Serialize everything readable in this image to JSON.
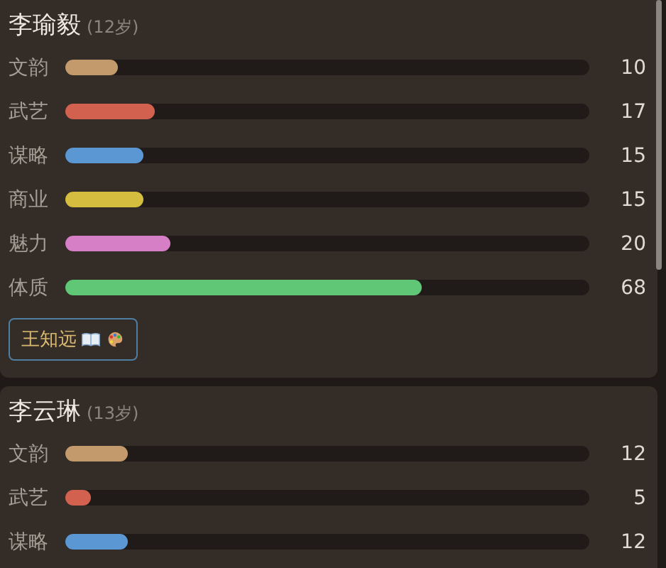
{
  "characters": [
    {
      "name": "李瑜毅",
      "age": "(12岁)",
      "stats": [
        {
          "label": "文韵",
          "level": 0.1,
          "value": "10",
          "color": "#c39a6b"
        },
        {
          "label": "武艺",
          "level": 0.17,
          "value": "17",
          "color": "#d2614f"
        },
        {
          "label": "谋略",
          "level": 0.15,
          "value": "15",
          "color": "#5b97d3"
        },
        {
          "label": "商业",
          "level": 0.15,
          "value": "15",
          "color": "#d4bd3f"
        },
        {
          "label": "魅力",
          "level": 0.2,
          "value": "20",
          "color": "#d67ec6"
        },
        {
          "label": "体质",
          "level": 0.68,
          "value": "68",
          "color": "#5fc775"
        }
      ],
      "tags": [
        {
          "label": "王知远"
        }
      ]
    },
    {
      "name": "李云琳",
      "age": "(13岁)",
      "stats": [
        {
          "label": "文韵",
          "level": 0.12,
          "value": "12",
          "color": "#c39a6b"
        },
        {
          "label": "武艺",
          "level": 0.05,
          "value": "5",
          "color": "#d2614f"
        },
        {
          "label": "谋略",
          "level": 0.12,
          "value": "12",
          "color": "#5b97d3"
        }
      ]
    }
  ]
}
